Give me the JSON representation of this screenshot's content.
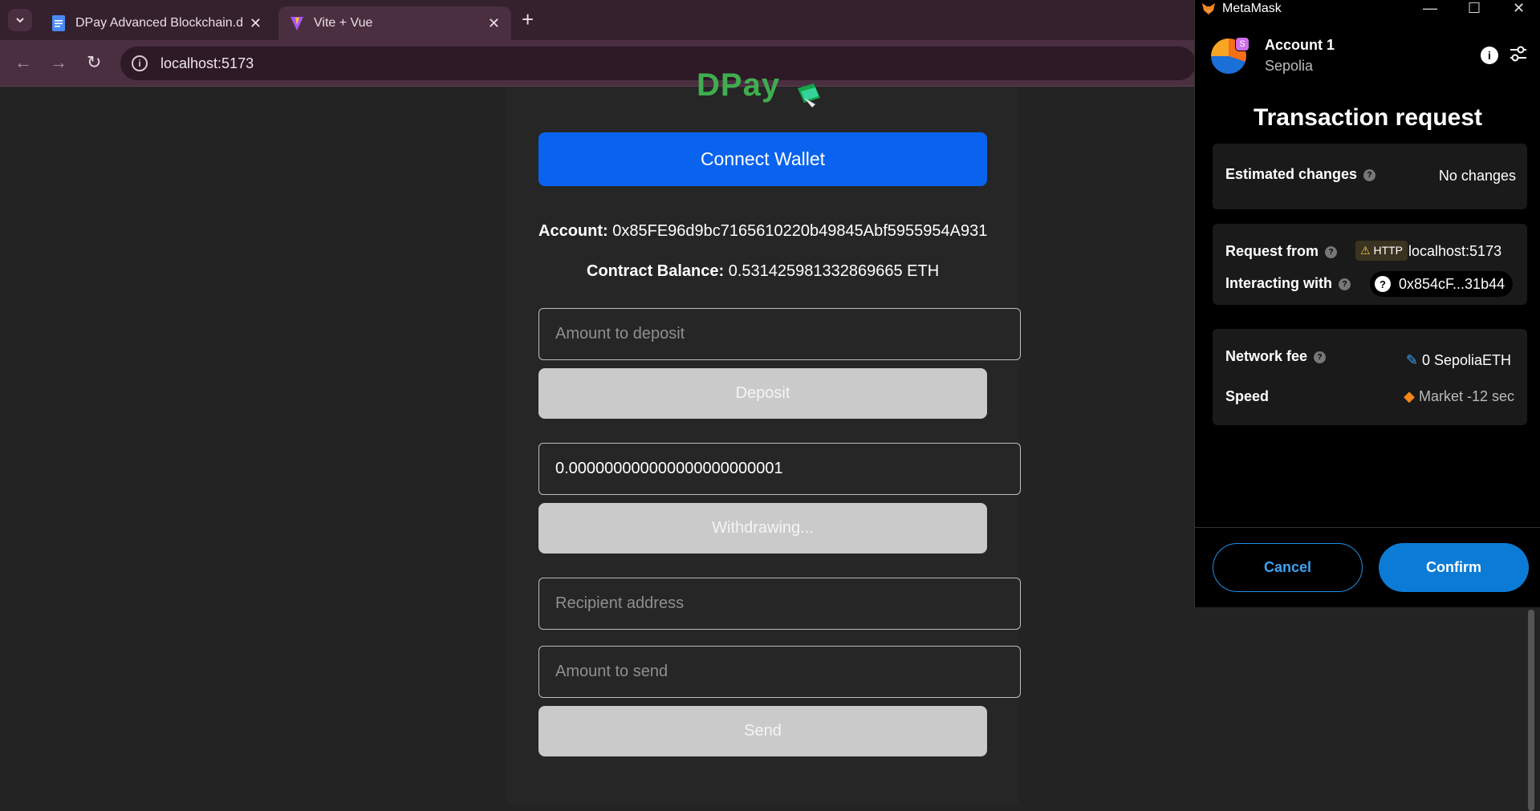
{
  "browser": {
    "tabs": [
      {
        "title": "DPay Advanced Blockchain.doc",
        "active": false
      },
      {
        "title": "Vite + Vue",
        "active": true
      }
    ],
    "url": "localhost:5173"
  },
  "app": {
    "logo_text": "DPay",
    "connect_button": "Connect Wallet",
    "account_label": "Account:",
    "account_value": "0x85FE96d9bc7165610220b49845Abf5955954A931",
    "balance_label": "Contract Balance:",
    "balance_value": "0.531425981332869665 ETH",
    "deposit_placeholder": "Amount to deposit",
    "deposit_button": "Deposit",
    "withdraw_value": "0.000000000000000000000001",
    "withdraw_button": "Withdrawing...",
    "recipient_placeholder": "Recipient address",
    "send_amount_placeholder": "Amount to send",
    "send_button": "Send"
  },
  "metamask": {
    "window_title": "MetaMask",
    "account_name": "Account 1",
    "network": "Sepolia",
    "avatar_badge": "S",
    "title": "Transaction request",
    "estimated_changes_label": "Estimated changes",
    "estimated_changes_value": "No changes",
    "request_from_label": "Request from",
    "http_badge": "HTTP",
    "request_from_value": "localhost:5173",
    "interacting_with_label": "Interacting with",
    "interacting_with_value": "0x854cF...31b44",
    "network_fee_label": "Network fee",
    "network_fee_value": "0 SepoliaETH",
    "speed_label": "Speed",
    "speed_value": "Market -12 sec",
    "cancel_button": "Cancel",
    "confirm_button": "Confirm"
  }
}
